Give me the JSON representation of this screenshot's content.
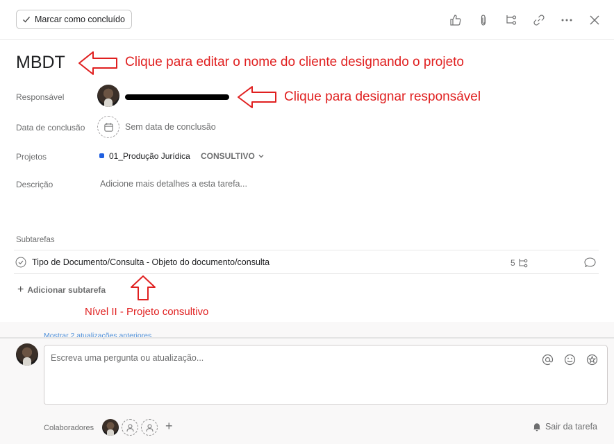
{
  "header": {
    "complete_label": "Marcar como concluído",
    "toolbar_icons": [
      "thumbs-up-icon",
      "paperclip-icon",
      "subtask-icon",
      "link-icon",
      "more-icon",
      "close-icon"
    ]
  },
  "task": {
    "title": "MBDT",
    "fields": {
      "assignee_label": "Responsável",
      "due_label": "Data de conclusão",
      "due_value": "Sem data de conclusão",
      "projects_label": "Projetos",
      "project_name": "01_Produção Jurídica",
      "project_section": "CONSULTIVO",
      "description_label": "Descrição",
      "description_placeholder": "Adicione mais detalhes a esta tarefa..."
    },
    "subtasks": {
      "heading": "Subtarefas",
      "items": [
        {
          "name": "Tipo de Documento/Consulta - Objeto do documento/consulta",
          "subtask_count": "5"
        }
      ],
      "add_label": "Adicionar subtarefa"
    }
  },
  "annotations": {
    "title_note": "Clique para editar o nome do cliente designando o projeto",
    "assignee_note": "Clique para designar responsável",
    "subtask_note": "Nível II - Projeto consultivo",
    "color": "#e02020"
  },
  "activity": {
    "show_updates": "Mostrar 2 atualizações anteriores",
    "comment_placeholder": "Escreva uma pergunta ou atualização...",
    "collaborators_label": "Colaboradores",
    "leave_label": "Sair da tarefa"
  }
}
